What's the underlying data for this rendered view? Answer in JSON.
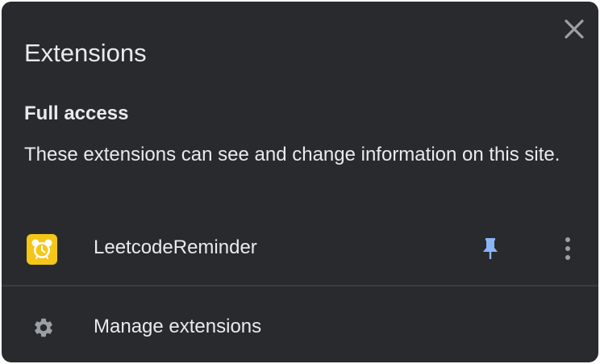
{
  "popup": {
    "title": "Extensions",
    "close_icon": "close-icon"
  },
  "full_access": {
    "heading": "Full access",
    "description": "These extensions can see and change information on this site."
  },
  "extensions": [
    {
      "name": "LeetcodeReminder",
      "icon": "alarm-clock-icon",
      "icon_bg": "#f5c518",
      "pinned": true,
      "pin_color": "#8ab4f8"
    }
  ],
  "footer": {
    "manage_label": "Manage extensions",
    "icon": "gear-icon"
  },
  "colors": {
    "background": "#292a2d",
    "text": "#e8eaed",
    "icon_gray": "#9aa0a6",
    "pin_blue": "#8ab4f8"
  }
}
